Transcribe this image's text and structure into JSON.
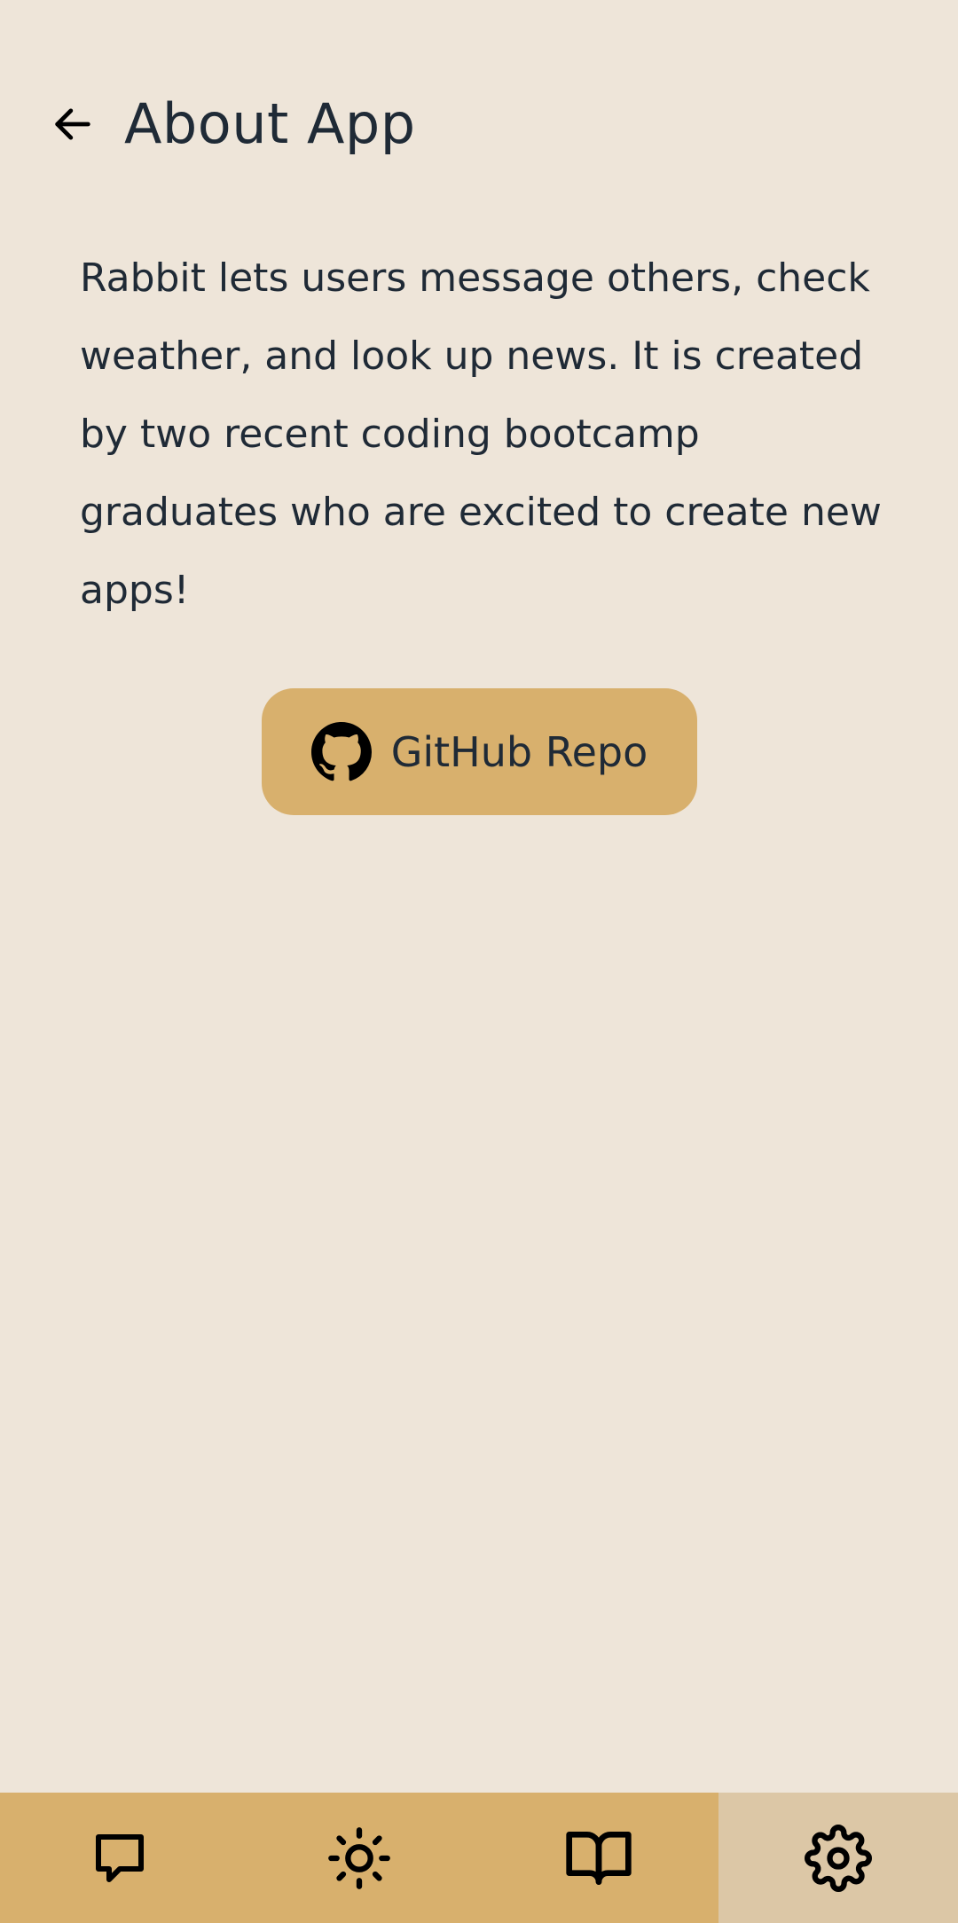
{
  "header": {
    "title": "About App",
    "back_icon": "arrow-left-icon"
  },
  "content": {
    "description": "Rabbit lets users message others, check weather, and look up news. It is created by two recent coding bootcamp graduates who are excited to create new apps!"
  },
  "github_button": {
    "label": "GitHub Repo",
    "icon": "github-icon"
  },
  "bottom_nav": {
    "items": [
      {
        "icon": "message-icon",
        "active": false
      },
      {
        "icon": "sun-icon",
        "active": false
      },
      {
        "icon": "book-icon",
        "active": false
      },
      {
        "icon": "gear-icon",
        "active": true
      }
    ]
  },
  "colors": {
    "background": "#EEE5D9",
    "accent": "#D8B06D",
    "active_tab": "#DCC7A6",
    "text": "#1F2A36"
  }
}
